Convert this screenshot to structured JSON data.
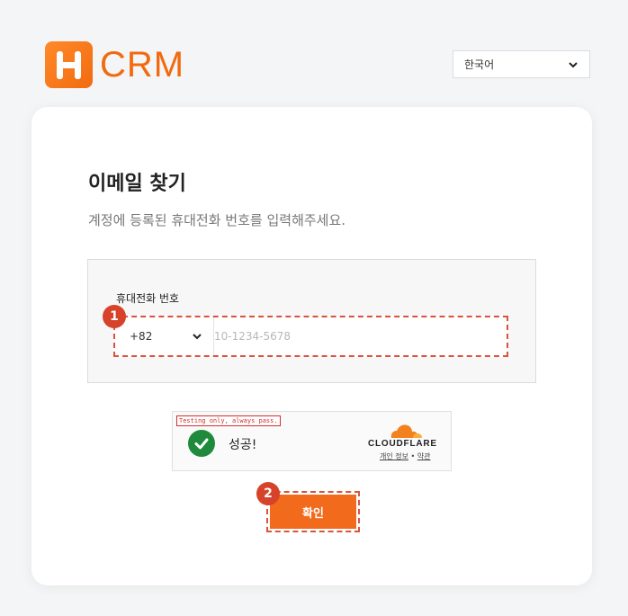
{
  "brand": {
    "name": "CRM",
    "color": "#f26a10",
    "logo_letter": "H"
  },
  "language_select": {
    "value": "한국어",
    "icon": "chevron-down-icon"
  },
  "page": {
    "title": "이메일 찾기",
    "subtitle": "계정에 등록된 휴대전화 번호를 입력해주세요."
  },
  "phone_field": {
    "label": "휴대전화 번호",
    "country_code": "+82",
    "placeholder": "10-1234-5678",
    "value": ""
  },
  "captcha": {
    "testing_note": "Testing only, always pass.",
    "status": "성공!",
    "provider": "CLOUDFLARE",
    "privacy_link": "개인 정보",
    "separator": "•",
    "terms_link": "약관",
    "status_color": "#1f8a3c"
  },
  "confirm_button": {
    "label": "확인",
    "color": "#f26a1b"
  },
  "annotations": {
    "step1": "1",
    "step2": "2",
    "color": "#d6432a"
  }
}
